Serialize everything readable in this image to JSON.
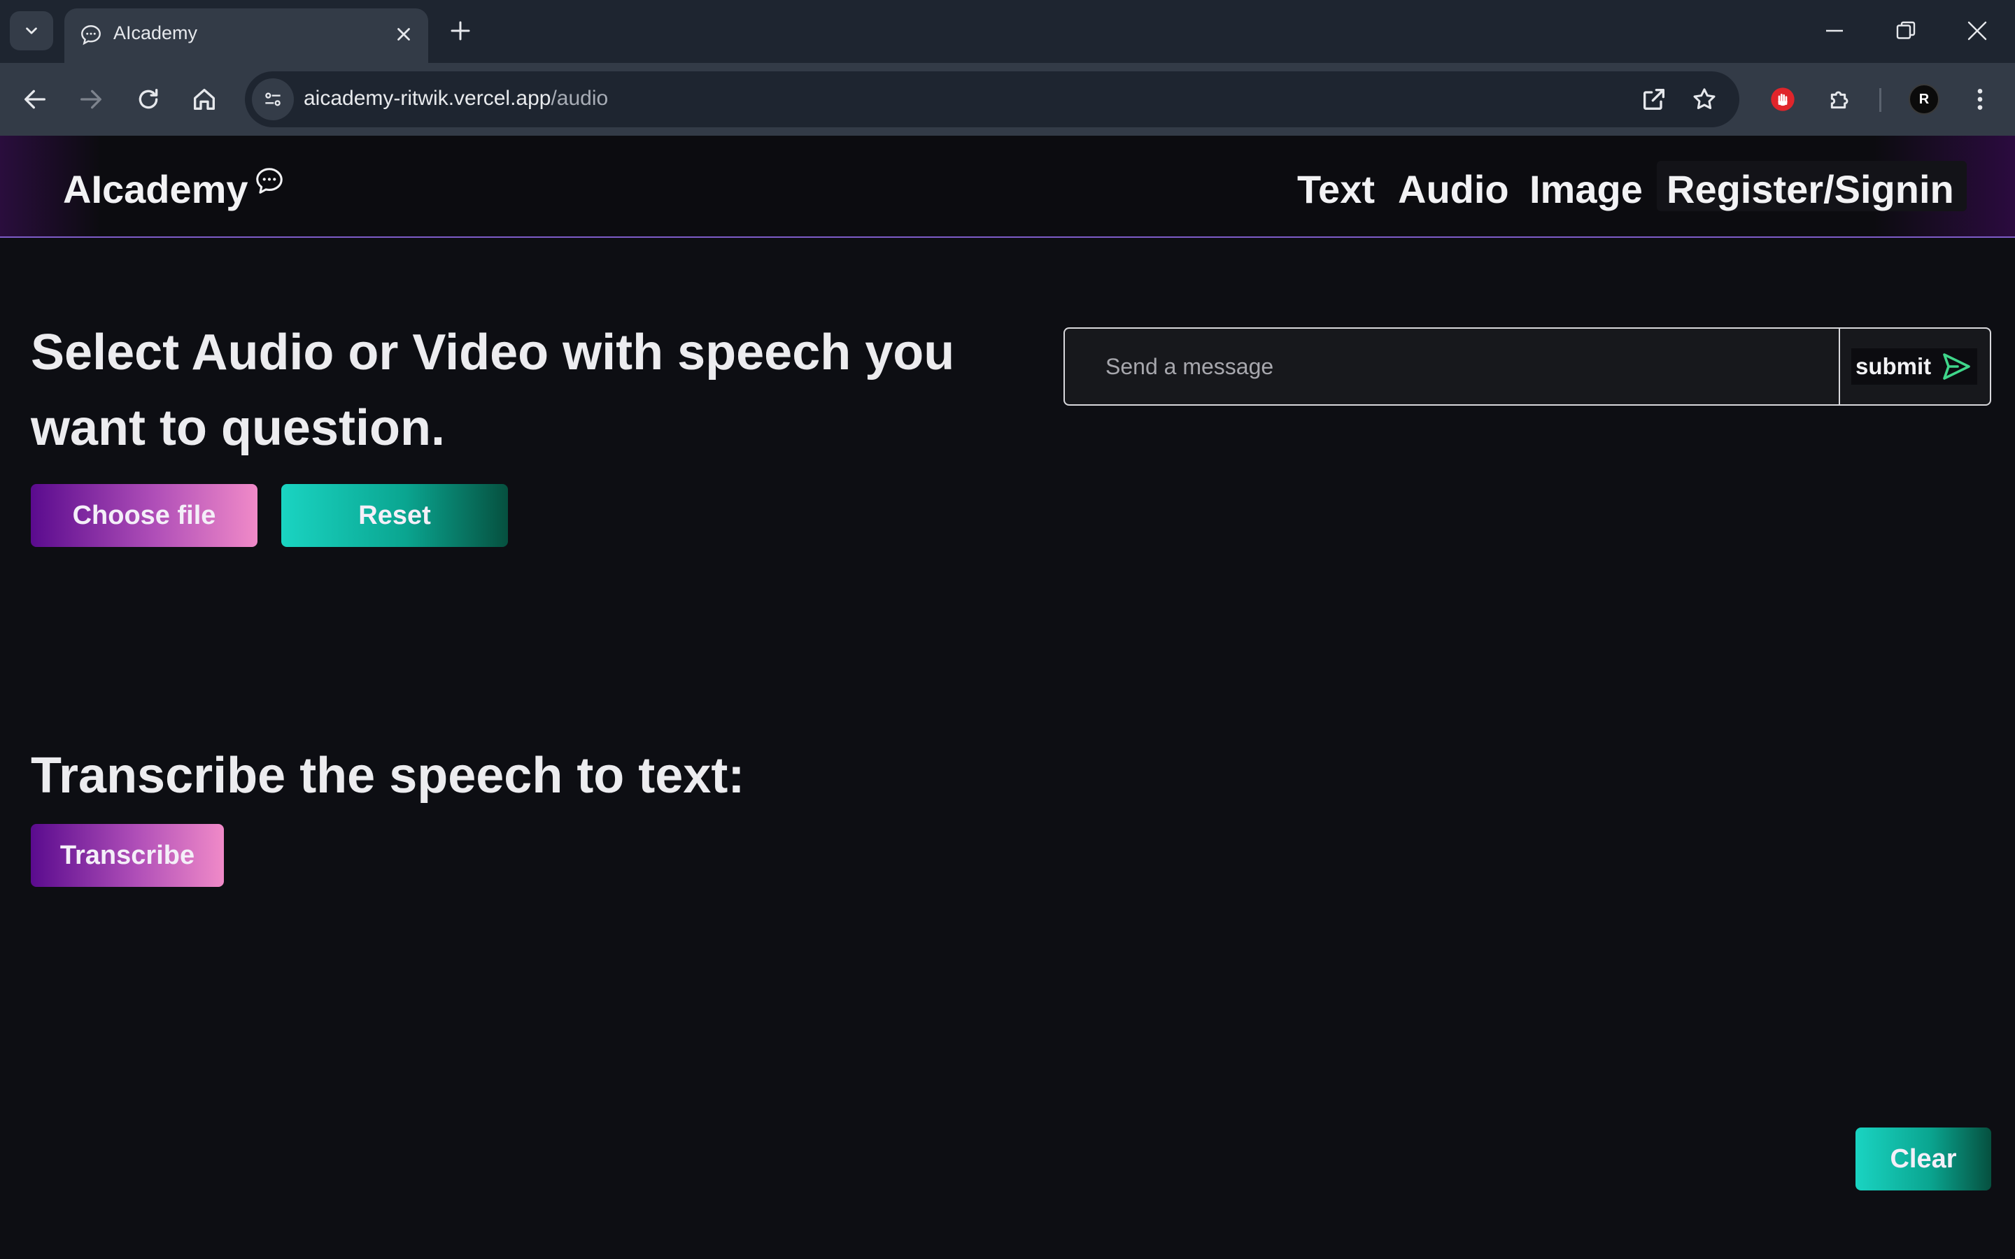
{
  "browser": {
    "tab_title": "AIcademy",
    "url_host": "aicademy-ritwik.vercel.app",
    "url_path": "/audio",
    "profile_initial": "R"
  },
  "nav": {
    "brand": "AIcademy",
    "links": [
      "Text",
      "Audio",
      "Image"
    ],
    "signin": "Register/Signin"
  },
  "main": {
    "headline": "Select Audio or Video with speech you want to question.",
    "choose_file_label": "Choose file",
    "reset_label": "Reset",
    "transcribe_heading": "Transcribe the speech to text:",
    "transcribe_label": "Transcribe",
    "clear_label": "Clear"
  },
  "chat": {
    "placeholder": "Send a message",
    "submit_label": "submit"
  },
  "colors": {
    "accent_purple": "#5a0b8e",
    "accent_pink": "#f08ac8",
    "accent_teal": "#1ad4c2",
    "send_green": "#3fd68a"
  }
}
